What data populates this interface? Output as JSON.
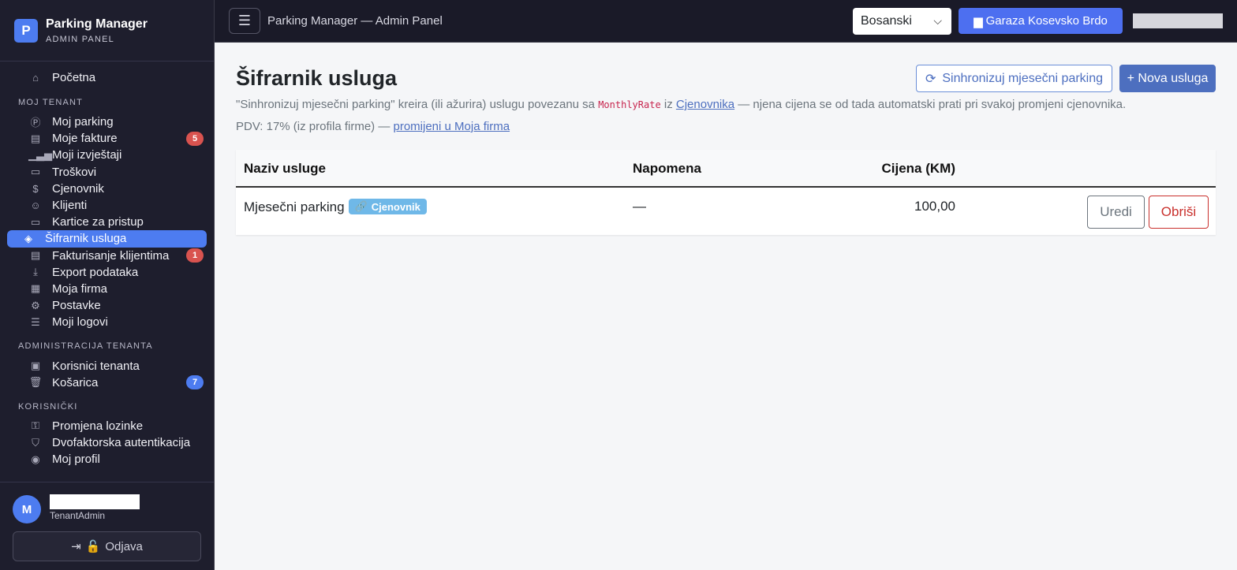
{
  "sidebar": {
    "brand_letter": "P",
    "brand_title": "Parking Manager",
    "brand_subtitle": "ADMIN PANEL",
    "home": {
      "label": "Početna",
      "icon": "home-icon"
    },
    "sections": [
      {
        "title": "MOJ TENANT",
        "items": [
          {
            "label": "Moj parking",
            "icon": "parking-icon",
            "badge": null
          },
          {
            "label": "Moje fakture",
            "icon": "invoice-icon",
            "badge": "5"
          },
          {
            "label": "Moji izvještaji",
            "icon": "chart-icon",
            "badge": null
          },
          {
            "label": "Troškovi",
            "icon": "cash-icon",
            "badge": null
          },
          {
            "label": "Cjenovnik",
            "icon": "coins-icon",
            "badge": null
          },
          {
            "label": "Klijenti",
            "icon": "people-icon",
            "badge": null
          },
          {
            "label": "Kartice za pristup",
            "icon": "card-icon",
            "badge": null
          },
          {
            "label": "Šifrarnik usluga",
            "icon": "tags-icon",
            "badge": null,
            "active": true
          },
          {
            "label": "Fakturisanje klijentima",
            "icon": "receipt-icon",
            "badge": "1"
          },
          {
            "label": "Export podataka",
            "icon": "download-icon",
            "badge": null
          },
          {
            "label": "Moja firma",
            "icon": "building-icon",
            "badge": null
          },
          {
            "label": "Postavke",
            "icon": "gear-icon",
            "badge": null
          },
          {
            "label": "Moji logovi",
            "icon": "log-icon",
            "badge": null
          }
        ]
      },
      {
        "title": "ADMINISTRACIJA TENANTA",
        "items": [
          {
            "label": "Korisnici tenanta",
            "icon": "user-badge-icon",
            "badge": null
          },
          {
            "label": "Košarica",
            "icon": "trash-icon",
            "badge": "7"
          }
        ]
      },
      {
        "title": "KORISNIČKI",
        "items": [
          {
            "label": "Promjena lozinke",
            "icon": "key-icon",
            "badge": null
          },
          {
            "label": "Dvofaktorska autentikacija",
            "icon": "shield-icon",
            "badge": null
          },
          {
            "label": "Moj profil",
            "icon": "person-circle-icon",
            "badge": null
          }
        ]
      }
    ],
    "user": {
      "avatar_letter": "M",
      "role": "TenantAdmin"
    },
    "logout_label": "Odjava"
  },
  "topbar": {
    "title": "Parking Manager — Admin Panel",
    "language": "Bosanski",
    "garage_label": "Garaza Kosevsko Brdo"
  },
  "main": {
    "title": "Šifrarnik usluga",
    "sync_label": "Sinhronizuj mjesečni parking",
    "new_label": "+ Nova usluga",
    "desc_part1": "\"Sinhronizuj mjesečni parking\" kreira (ili ažurira) uslugu povezanu sa",
    "desc_code": "MonthlyRate",
    "desc_part2": "iz",
    "desc_link": "Cjenovnika",
    "desc_part3": "— njena cijena se od tada automatski prati pri svakoj promjeni cjenovnika.",
    "pdv_text": "PDV: 17% (iz profila firme) —",
    "pdv_link": "promijeni u Moja firma",
    "table": {
      "headers": {
        "name": "Naziv usluge",
        "note": "Napomena",
        "price": "Cijena (KM)"
      },
      "rows": [
        {
          "name": "Mjesečni parking",
          "tag": "Cjenovnik",
          "note": "—",
          "price": "100,00",
          "edit": "Uredi",
          "delete": "Obriši"
        }
      ]
    }
  },
  "colors": {
    "accent": "#4d7cf0",
    "sidebar_bg": "#1e1e2d",
    "danger": "#c9302c",
    "tag": "#6fb8e8"
  }
}
